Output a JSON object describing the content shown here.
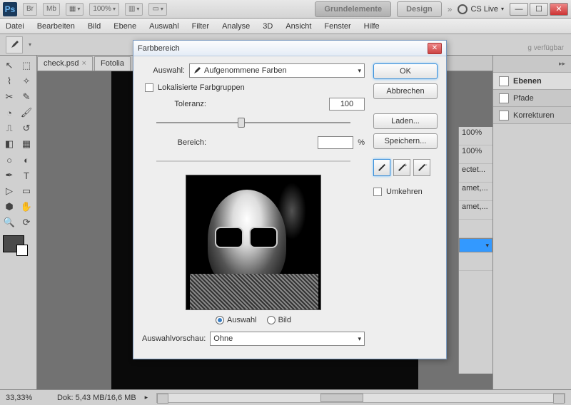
{
  "titlebar": {
    "zoom": "100%",
    "tab_grund": "Grundelemente",
    "tab_design": "Design",
    "cslive": "CS Live"
  },
  "menus": [
    "Datei",
    "Bearbeiten",
    "Bild",
    "Ebene",
    "Auswahl",
    "Filter",
    "Analyse",
    "3D",
    "Ansicht",
    "Fenster",
    "Hilfe"
  ],
  "avail_text": "g verfügbar",
  "doctabs": {
    "t1": "check.psd",
    "t2": "Fotolia"
  },
  "panels": {
    "ebenen": "Ebenen",
    "pfade": "Pfade",
    "korr": "Korrekturen"
  },
  "layers_snips": [
    "100%",
    "100%",
    "ectet...",
    "amet,...",
    "amet,..."
  ],
  "dialog": {
    "title": "Farbbereich",
    "auswahl_label": "Auswahl:",
    "auswahl_value": "Aufgenommene Farben",
    "lokal": "Lokalisierte Farbgruppen",
    "toleranz_label": "Toleranz:",
    "toleranz_value": "100",
    "bereich_label": "Bereich:",
    "bereich_unit": "%",
    "radio_auswahl": "Auswahl",
    "radio_bild": "Bild",
    "vorschau_label": "Auswahlvorschau:",
    "vorschau_value": "Ohne",
    "ok": "OK",
    "cancel": "Abbrechen",
    "load": "Laden...",
    "save": "Speichern...",
    "umkehren": "Umkehren"
  },
  "status": {
    "zoom": "33,33%",
    "dok": "Dok: 5,43 MB/16,6 MB"
  }
}
